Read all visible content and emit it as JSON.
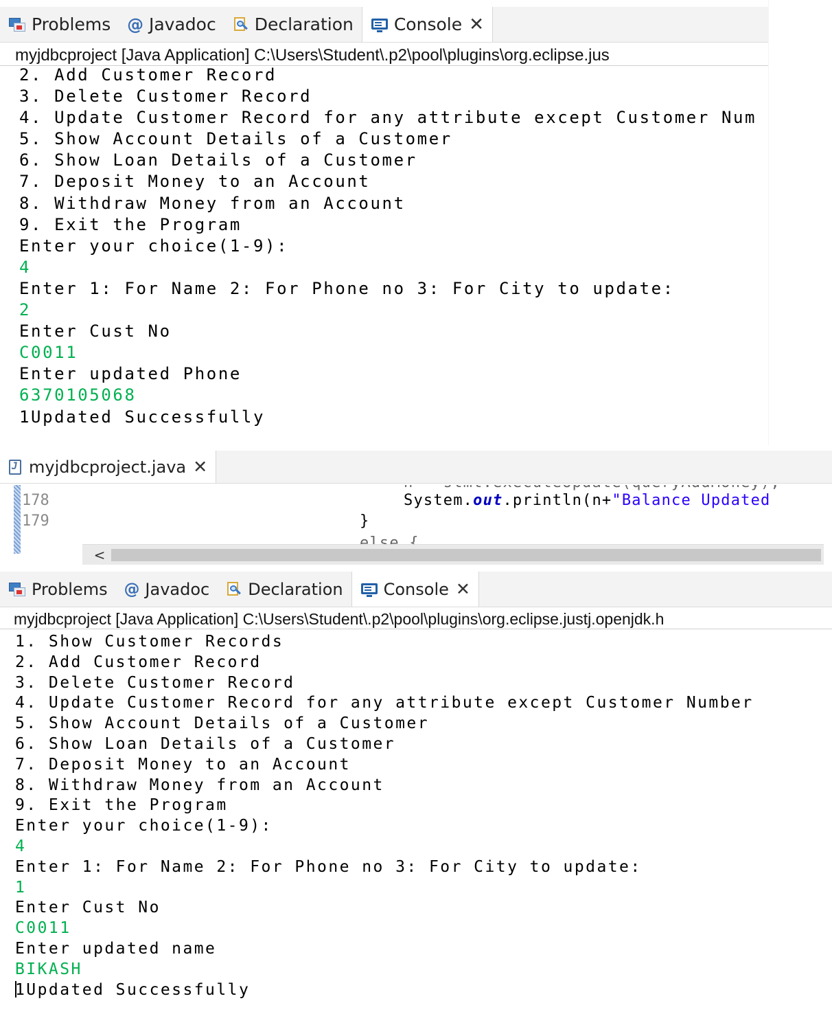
{
  "console_tabs": {
    "problems": "Problems",
    "javadoc": "Javadoc",
    "declaration": "Declaration",
    "console": "Console",
    "close_glyph": "✕"
  },
  "icons": {
    "problems": "problems-icon",
    "javadoc": "at-sign-icon",
    "declaration": "declaration-icon",
    "console": "console-icon",
    "java_file": "java-file-icon"
  },
  "colors": {
    "console_output": "#000000",
    "console_input": "#00b050",
    "keyword": "#7f0055",
    "string": "#2a00ff",
    "field": "#0000c0"
  },
  "console1": {
    "launch_label": "myjdbcproject [Java Application] C:\\Users\\Student\\.p2\\pool\\plugins\\org.eclipse.jus",
    "lines": [
      {
        "text": "2. Add Customer Record",
        "kind": "out"
      },
      {
        "text": "3. Delete Customer Record",
        "kind": "out"
      },
      {
        "text": "4. Update Customer Record for any attribute except Customer Num",
        "kind": "out"
      },
      {
        "text": "5. Show Account Details of a Customer",
        "kind": "out"
      },
      {
        "text": "6. Show Loan Details of a Customer",
        "kind": "out"
      },
      {
        "text": "7. Deposit Money to an Account",
        "kind": "out"
      },
      {
        "text": "8. Withdraw Money from an Account",
        "kind": "out"
      },
      {
        "text": "9. Exit the Program",
        "kind": "out"
      },
      {
        "text": "Enter your choice(1-9):",
        "kind": "out"
      },
      {
        "text": "4",
        "kind": "in"
      },
      {
        "text": "Enter 1: For Name 2: For Phone no 3: For City to update:",
        "kind": "out"
      },
      {
        "text": "2",
        "kind": "in"
      },
      {
        "text": "Enter Cust No",
        "kind": "out"
      },
      {
        "text": "C0011",
        "kind": "in"
      },
      {
        "text": "Enter updated Phone",
        "kind": "out"
      },
      {
        "text": "6370105068",
        "kind": "in"
      },
      {
        "text": "1Updated Successfully",
        "kind": "out"
      }
    ]
  },
  "editor": {
    "tab_label": "myjdbcproject.java",
    "lines": [
      {
        "num": "178",
        "pre": "System.",
        "field": "out",
        "mid": ".println(n+",
        "str": "\"Balance Updated"
      },
      {
        "num": "179",
        "brace": "}"
      }
    ],
    "scroll_left_glyph": "<"
  },
  "console2": {
    "launch_label": "myjdbcproject [Java Application] C:\\Users\\Student\\.p2\\pool\\plugins\\org.eclipse.justj.openjdk.h",
    "lines": [
      {
        "text": "1. Show Customer Records",
        "kind": "out"
      },
      {
        "text": "2. Add Customer Record",
        "kind": "out"
      },
      {
        "text": "3. Delete Customer Record",
        "kind": "out"
      },
      {
        "text": "4. Update Customer Record for any attribute except Customer Number",
        "kind": "out"
      },
      {
        "text": "5. Show Account Details of a Customer",
        "kind": "out"
      },
      {
        "text": "6. Show Loan Details of a Customer",
        "kind": "out"
      },
      {
        "text": "7. Deposit Money to an Account",
        "kind": "out"
      },
      {
        "text": "8. Withdraw Money from an Account",
        "kind": "out"
      },
      {
        "text": "9. Exit the Program",
        "kind": "out"
      },
      {
        "text": "Enter your choice(1-9):",
        "kind": "out"
      },
      {
        "text": "4",
        "kind": "in"
      },
      {
        "text": "Enter 1: For Name 2: For Phone no 3: For City to update:",
        "kind": "out"
      },
      {
        "text": "1",
        "kind": "in"
      },
      {
        "text": "Enter Cust No",
        "kind": "out"
      },
      {
        "text": "C0011",
        "kind": "in"
      },
      {
        "text": "Enter updated name",
        "kind": "out"
      },
      {
        "text": "BIKASH",
        "kind": "in"
      },
      {
        "text": "1Updated Successfully",
        "kind": "out"
      }
    ]
  }
}
